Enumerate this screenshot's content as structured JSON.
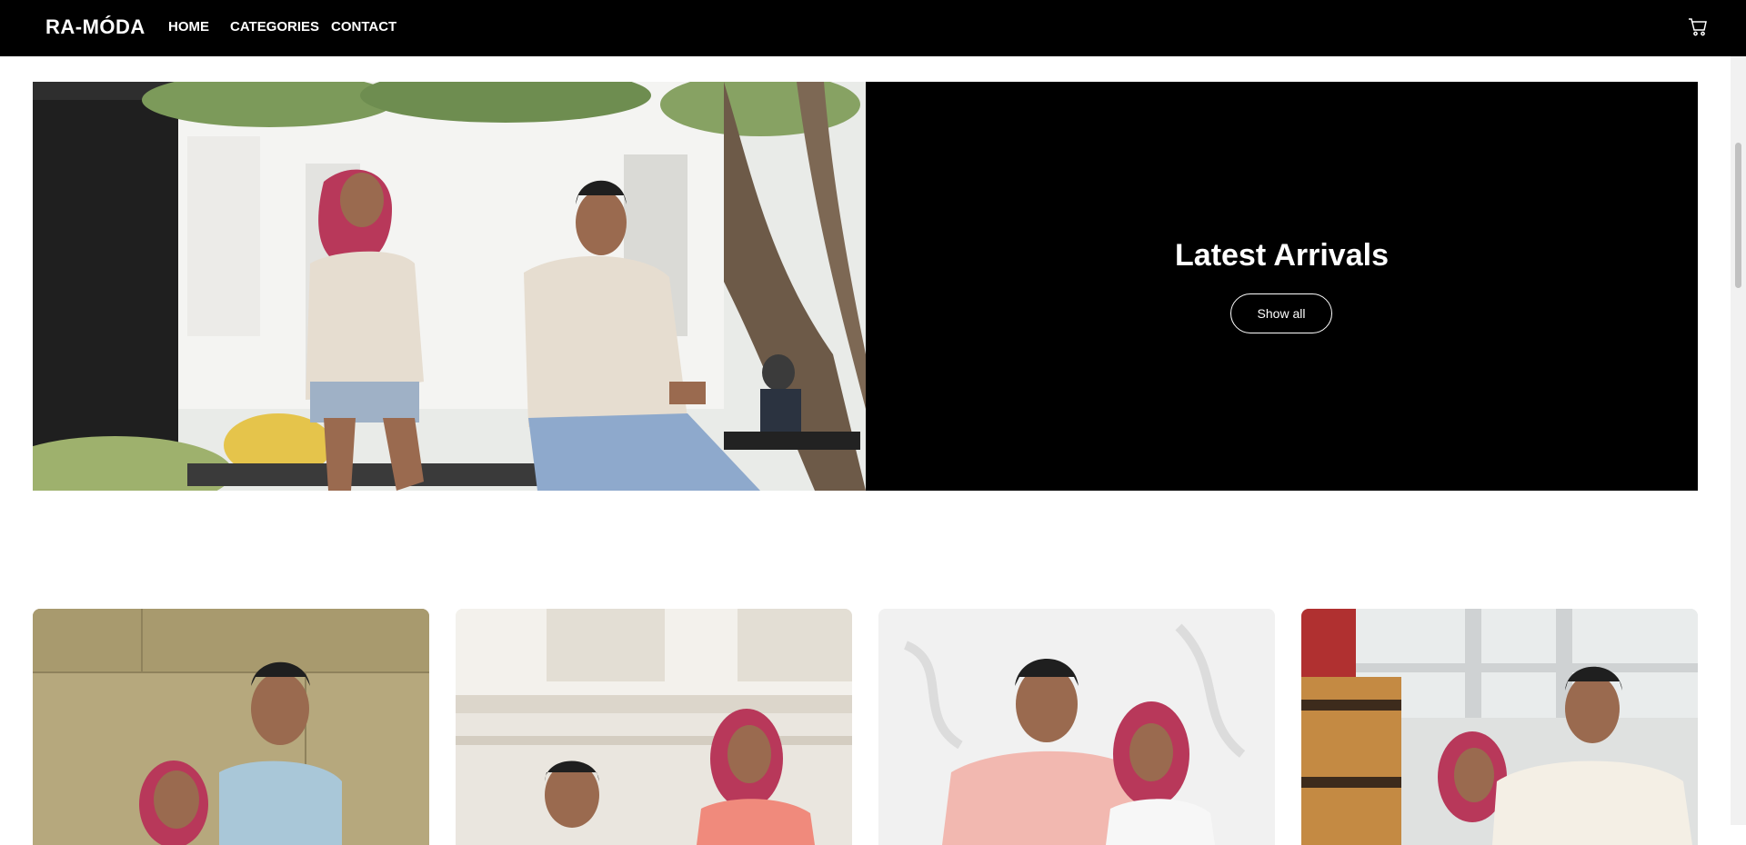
{
  "nav": {
    "brand": "RA-MÓDA",
    "links": [
      "HOME",
      "CATEGORIES",
      "CONTACT"
    ],
    "cart_icon": "cart-icon"
  },
  "hero": {
    "title": "Latest Arrivals",
    "button_label": "Show all"
  },
  "products": [
    {
      "name": "product-1"
    },
    {
      "name": "product-2"
    },
    {
      "name": "product-3"
    },
    {
      "name": "product-4"
    }
  ],
  "colors": {
    "nav_background": "#000000",
    "hero_background": "#000000",
    "accent_text": "#ffffff"
  }
}
